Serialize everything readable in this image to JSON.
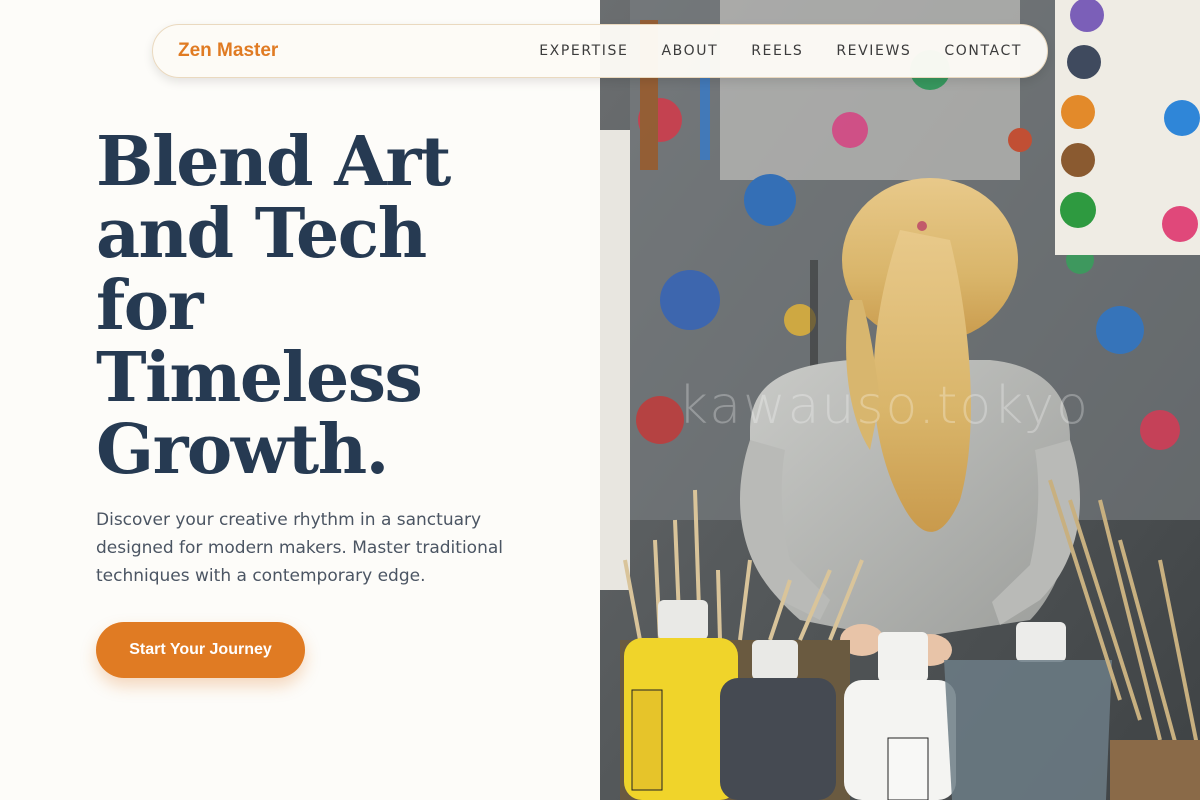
{
  "brand": {
    "name": "Zen Master",
    "color": "#e07b23"
  },
  "nav": {
    "links": [
      {
        "label": "EXPERTISE"
      },
      {
        "label": "ABOUT"
      },
      {
        "label": "REELS"
      },
      {
        "label": "REVIEWS"
      },
      {
        "label": "CONTACT"
      }
    ]
  },
  "hero": {
    "headline_lines": [
      "Blend Art",
      "and Tech",
      "for",
      "Timeless",
      "Growth."
    ],
    "subtext": "Discover your creative rhythm in a sanctuary designed for modern makers. Master traditional techniques with a contemporary edge.",
    "cta_label": "Start Your Journey",
    "image": {
      "description_icon": "photo-child-painting-studio",
      "watermark": "kawauso.tokyo"
    }
  },
  "colors": {
    "accent": "#e07b23",
    "headline": "#263a52",
    "body_text": "#4b5563",
    "background": "#fdfcf9"
  }
}
